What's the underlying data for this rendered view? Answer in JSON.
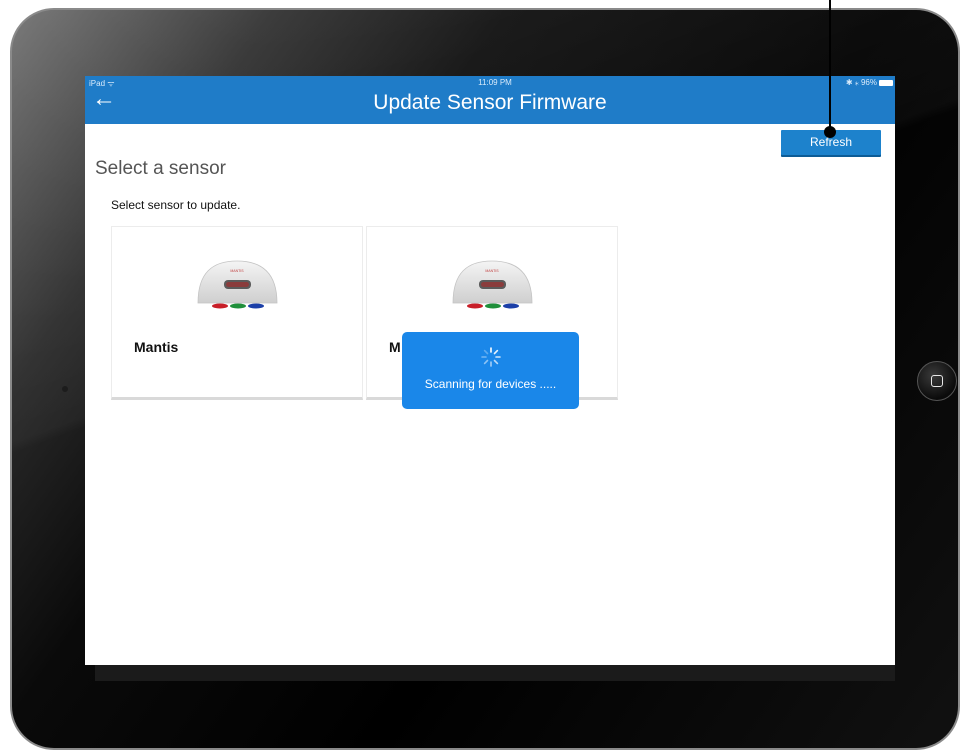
{
  "status_bar": {
    "device": "iPad ᯤ",
    "time": "11:09 PM",
    "battery": "✱ ⁎ 96%"
  },
  "header": {
    "back_icon": "←",
    "title": "Update Sensor Firmware"
  },
  "toolbar": {
    "refresh_label": "Refresh"
  },
  "main": {
    "section_title": "Select a sensor",
    "instructions": "Select sensor to update.",
    "sensors": [
      {
        "name": "Mantis",
        "logo": "MANTIS"
      },
      {
        "name": "M",
        "logo": "MANTIS"
      }
    ]
  },
  "overlay": {
    "message": "Scanning for devices ....."
  },
  "colors": {
    "accent": "#1f7cc8",
    "overlay": "#1a87e9",
    "led_red": "#c81e28",
    "led_green": "#1f8f3a",
    "led_blue": "#1b3fa8"
  }
}
